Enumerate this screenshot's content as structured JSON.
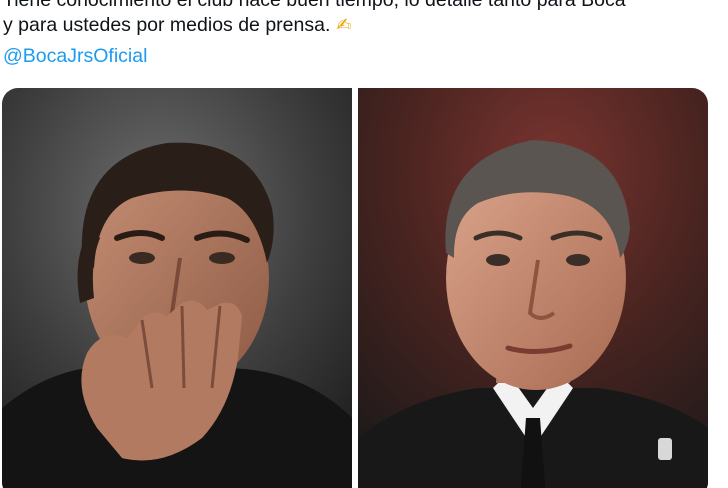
{
  "tweet": {
    "text_lines": [
      "Tiene conocimiento el club hace buen tiempo, lo detalle tanto para Boca",
      "y para ustedes por medios de prensa."
    ],
    "emoji": "✍",
    "mention": "@BocaJrsOficial"
  },
  "media": {
    "photo_count": 2,
    "left_photo_icon": "man-portrait-hand-on-mouth",
    "right_photo_icon": "man-portrait-suit"
  },
  "colors": {
    "text": "#0f1419",
    "link": "#1d9bf0"
  }
}
